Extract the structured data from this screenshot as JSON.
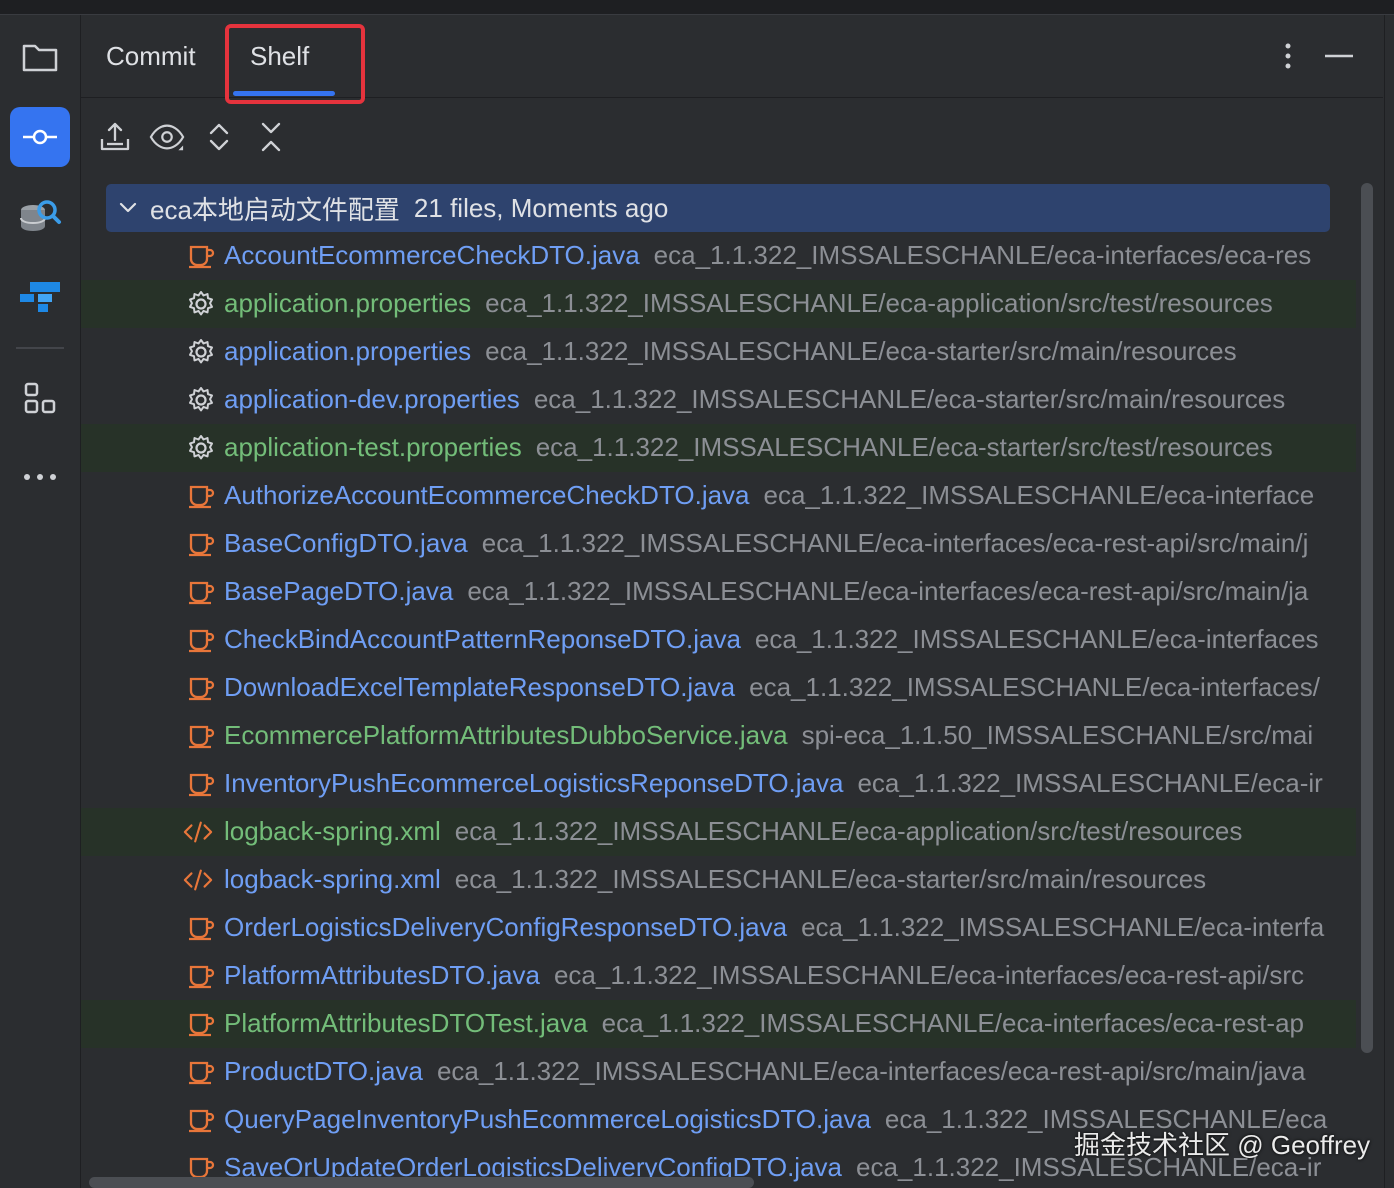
{
  "tabs": {
    "commit_label": "Commit",
    "shelf_label": "Shelf"
  },
  "toolbar": {
    "icons": [
      "unshelve-icon",
      "preview-eye-icon",
      "expand-all-icon",
      "collapse-all-icon"
    ]
  },
  "sidebar": {
    "icons": [
      "folder-icon",
      "commit-icon",
      "database-search-icon",
      "plugin-logo-icon",
      "structure-icon",
      "more-icon"
    ]
  },
  "shelf": {
    "group": {
      "title": "eca本地启动文件配置",
      "meta": "21 files, Moments ago"
    },
    "files": [
      {
        "name": "AccountEcommerceCheckDTO.java",
        "path": "eca_1.1.322_IMSSALESCHANLE/eca-interfaces/eca-res",
        "type": "java",
        "added": false
      },
      {
        "name": "application.properties",
        "path": "eca_1.1.322_IMSSALESCHANLE/eca-application/src/test/resources",
        "type": "properties",
        "added": true
      },
      {
        "name": "application.properties",
        "path": "eca_1.1.322_IMSSALESCHANLE/eca-starter/src/main/resources",
        "type": "properties",
        "added": false
      },
      {
        "name": "application-dev.properties",
        "path": "eca_1.1.322_IMSSALESCHANLE/eca-starter/src/main/resources",
        "type": "properties",
        "added": false
      },
      {
        "name": "application-test.properties",
        "path": "eca_1.1.322_IMSSALESCHANLE/eca-starter/src/test/resources",
        "type": "properties",
        "added": true
      },
      {
        "name": "AuthorizeAccountEcommerceCheckDTO.java",
        "path": "eca_1.1.322_IMSSALESCHANLE/eca-interface",
        "type": "java",
        "added": false
      },
      {
        "name": "BaseConfigDTO.java",
        "path": "eca_1.1.322_IMSSALESCHANLE/eca-interfaces/eca-rest-api/src/main/j",
        "type": "java",
        "added": false
      },
      {
        "name": "BasePageDTO.java",
        "path": "eca_1.1.322_IMSSALESCHANLE/eca-interfaces/eca-rest-api/src/main/ja",
        "type": "java",
        "added": false
      },
      {
        "name": "CheckBindAccountPatternReponseDTO.java",
        "path": "eca_1.1.322_IMSSALESCHANLE/eca-interfaces",
        "type": "java",
        "added": false
      },
      {
        "name": "DownloadExcelTemplateResponseDTO.java",
        "path": "eca_1.1.322_IMSSALESCHANLE/eca-interfaces/",
        "type": "java",
        "added": false
      },
      {
        "name": "EcommercePlatformAttributesDubboService.java",
        "path": "spi-eca_1.1.50_IMSSALESCHANLE/src/mai",
        "type": "java",
        "added": false,
        "green": true
      },
      {
        "name": "InventoryPushEcommerceLogisticsReponseDTO.java",
        "path": "eca_1.1.322_IMSSALESCHANLE/eca-ir",
        "type": "java",
        "added": false
      },
      {
        "name": "logback-spring.xml",
        "path": "eca_1.1.322_IMSSALESCHANLE/eca-application/src/test/resources",
        "type": "xml",
        "added": true
      },
      {
        "name": "logback-spring.xml",
        "path": "eca_1.1.322_IMSSALESCHANLE/eca-starter/src/main/resources",
        "type": "xml",
        "added": false
      },
      {
        "name": "OrderLogisticsDeliveryConfigResponseDTO.java",
        "path": "eca_1.1.322_IMSSALESCHANLE/eca-interfa",
        "type": "java",
        "added": false
      },
      {
        "name": "PlatformAttributesDTO.java",
        "path": "eca_1.1.322_IMSSALESCHANLE/eca-interfaces/eca-rest-api/src",
        "type": "java",
        "added": false
      },
      {
        "name": "PlatformAttributesDTOTest.java",
        "path": "eca_1.1.322_IMSSALESCHANLE/eca-interfaces/eca-rest-ap",
        "type": "java",
        "added": true
      },
      {
        "name": "ProductDTO.java",
        "path": "eca_1.1.322_IMSSALESCHANLE/eca-interfaces/eca-rest-api/src/main/java",
        "type": "java",
        "added": false
      },
      {
        "name": "QueryPageInventoryPushEcommerceLogisticsDTO.java",
        "path": "eca_1.1.322_IMSSALESCHANLE/eca",
        "type": "java",
        "added": false
      },
      {
        "name": "SaveOrUpdateOrderLogisticsDeliveryConfigDTO.java",
        "path": "eca_1.1.322_IMSSALESCHANLE/eca-ir",
        "type": "java",
        "added": false
      }
    ]
  },
  "colors": {
    "accent": "#3574f0",
    "highlight_box": "#e5333d",
    "file_modified": "#6f9ef4",
    "file_added": "#73bd79",
    "path_gray": "#8c8f95",
    "group_selected": "#2e436e",
    "java_icon": "#e8763a"
  },
  "watermark": "掘金技术社区 @ Geoffrey"
}
